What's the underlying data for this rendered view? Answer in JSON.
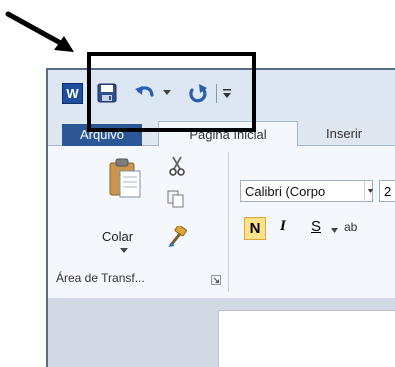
{
  "app": {
    "logo_letter": "W"
  },
  "quick_access": {
    "icons": [
      "word-logo-icon",
      "save-icon",
      "undo-icon",
      "redo-icon",
      "customize-toolbar-icon"
    ]
  },
  "tabs": {
    "file": "Arquivo",
    "home": "Página Inicial",
    "insert": "Inserir"
  },
  "clipboard": {
    "paste_label": "Colar",
    "group_label": "Área de Transf..."
  },
  "font": {
    "font_name": "Calibri (Corpo",
    "font_size": "2",
    "bold": "N",
    "italic": "I",
    "underline": "S",
    "extra": "ab"
  },
  "colors": {
    "file_tab": "#2b5797",
    "bold_active": "#fde28a",
    "highlight_border": "#000000"
  }
}
